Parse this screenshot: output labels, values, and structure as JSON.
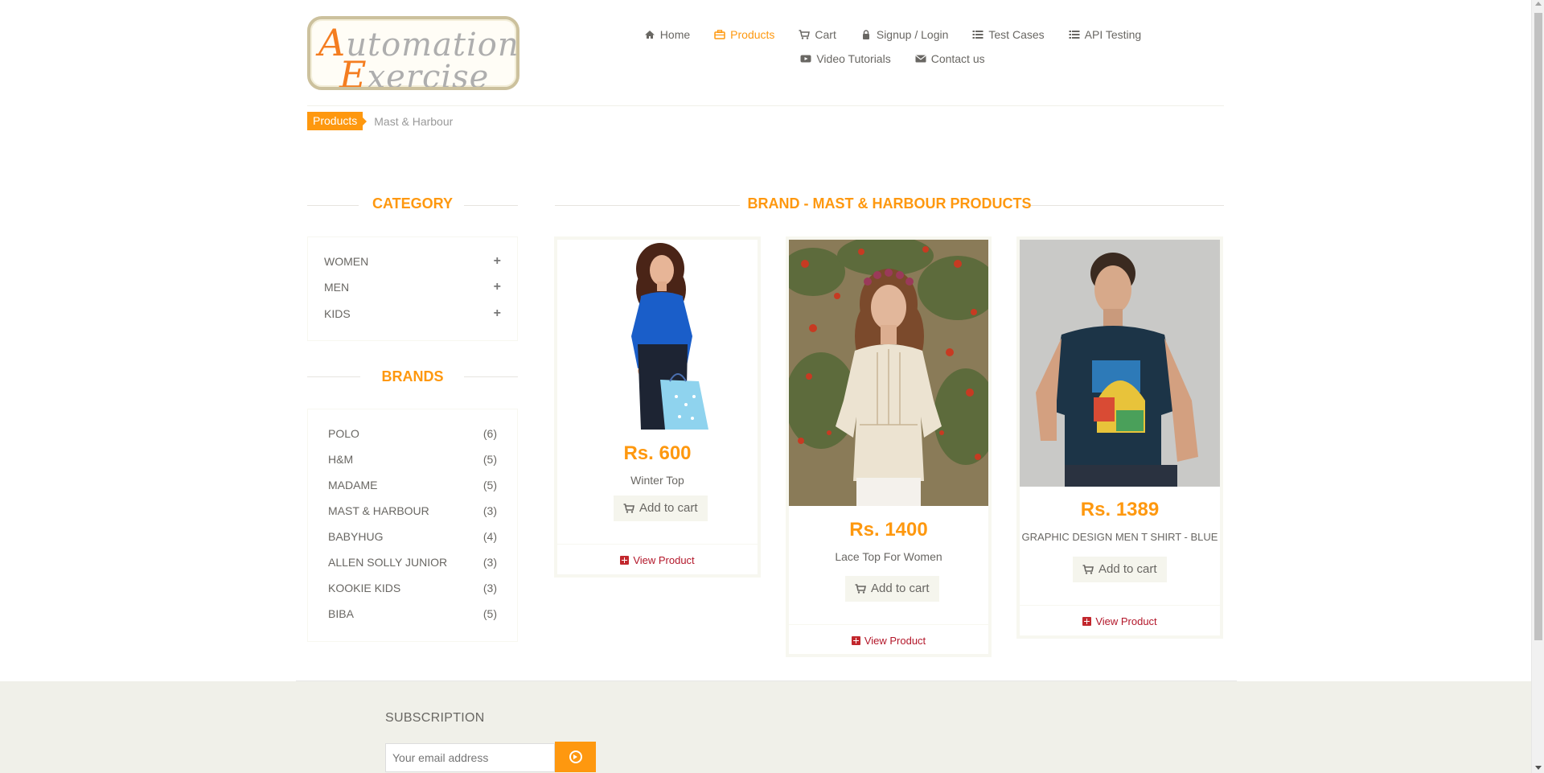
{
  "logo": {
    "line1_cap": "A",
    "line1_rest": "utomation",
    "line2_cap": "E",
    "line2_rest": "xercise"
  },
  "nav": {
    "row1": [
      {
        "label": "Home",
        "icon": "home-icon"
      },
      {
        "label": "Products",
        "icon": "products-icon",
        "active": true
      },
      {
        "label": "Cart",
        "icon": "cart-icon"
      },
      {
        "label": "Signup / Login",
        "icon": "lock-icon"
      },
      {
        "label": "Test Cases",
        "icon": "list-icon"
      },
      {
        "label": "API Testing",
        "icon": "list-icon"
      }
    ],
    "row2": [
      {
        "label": "Video Tutorials",
        "icon": "youtube-icon"
      },
      {
        "label": "Contact us",
        "icon": "envelope-icon"
      }
    ]
  },
  "breadcrumb": {
    "parent": "Products",
    "current": "Mast & Harbour"
  },
  "sidebar": {
    "category_title": "CATEGORY",
    "categories": [
      "WOMEN",
      "MEN",
      "KIDS"
    ],
    "brands_title": "BRANDS",
    "brands": [
      {
        "name": "POLO",
        "count": "(6)"
      },
      {
        "name": "H&M",
        "count": "(5)"
      },
      {
        "name": "MADAME",
        "count": "(5)"
      },
      {
        "name": "MAST & HARBOUR",
        "count": "(3)"
      },
      {
        "name": "BABYHUG",
        "count": "(4)"
      },
      {
        "name": "ALLEN SOLLY JUNIOR",
        "count": "(3)"
      },
      {
        "name": "KOOKIE KIDS",
        "count": "(3)"
      },
      {
        "name": "BIBA",
        "count": "(5)"
      }
    ]
  },
  "main": {
    "title": "BRAND - MAST & HARBOUR PRODUCTS",
    "products": [
      {
        "price": "Rs. 600",
        "name": "Winter Top",
        "add_label": "Add to cart",
        "view_label": "View Product"
      },
      {
        "price": "Rs. 1400",
        "name": "Lace Top For Women",
        "add_label": "Add to cart",
        "view_label": "View Product"
      },
      {
        "price": "Rs. 1389",
        "name": "GRAPHIC DESIGN MEN T SHIRT - BLUE",
        "add_label": "Add to cart",
        "view_label": "View Product"
      }
    ]
  },
  "footer": {
    "subscription_title": "SUBSCRIPTION",
    "email_placeholder": "Your email address"
  },
  "colors": {
    "accent": "#fe980f",
    "text": "#696763",
    "view_link": "#b3172a",
    "footer_bg": "#f0f0e9"
  }
}
